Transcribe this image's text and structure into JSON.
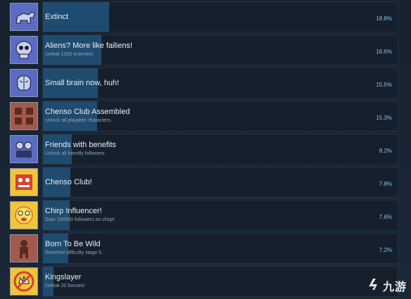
{
  "achievements": [
    {
      "title": "Extinct",
      "description": "",
      "percent": "18.8%",
      "fill": 0.188,
      "icon": "dinosaur-icon",
      "bg": "#5b6cc4"
    },
    {
      "title": "Aliens? More like failiens!",
      "description": "Defeat 1000 enemies!",
      "percent": "16.6%",
      "fill": 0.166,
      "icon": "alien-skull-icon",
      "bg": "#5b6cc4"
    },
    {
      "title": "Small brain now, huh!",
      "description": "",
      "percent": "15.5%",
      "fill": 0.155,
      "icon": "brain-icon",
      "bg": "#5b6cc4"
    },
    {
      "title": "Chenso Club Assembled",
      "description": "Unlock all playable characters.",
      "percent": "15.3%",
      "fill": 0.153,
      "icon": "characters-icon",
      "bg": "#a35a4a"
    },
    {
      "title": "Friends with benefits",
      "description": "Unlock all friendly followers.",
      "percent": "8.2%",
      "fill": 0.082,
      "icon": "followers-icon",
      "bg": "#5b6cc4"
    },
    {
      "title": "Chenso Club!",
      "description": "",
      "percent": "7.8%",
      "fill": 0.078,
      "icon": "club-icon",
      "bg": "#f0c53a"
    },
    {
      "title": "Chirp Influencer!",
      "description": "Gain 100000 followers on chirp!",
      "percent": "7.6%",
      "fill": 0.076,
      "icon": "chirp-face-icon",
      "bg": "#f0c53a"
    },
    {
      "title": "Born To Be Wild",
      "description": "Reached difficulty stage 5.",
      "percent": "7.2%",
      "fill": 0.072,
      "icon": "wild-character-icon",
      "bg": "#a35a4a"
    },
    {
      "title": "Kingslayer",
      "description": "Defeat 20 bosses!",
      "percent": "",
      "fill": 0.03,
      "icon": "no-crown-icon",
      "bg": "#f0c53a"
    }
  ],
  "watermark": {
    "text": "九游",
    "icon": "jiuyou-logo-icon"
  }
}
